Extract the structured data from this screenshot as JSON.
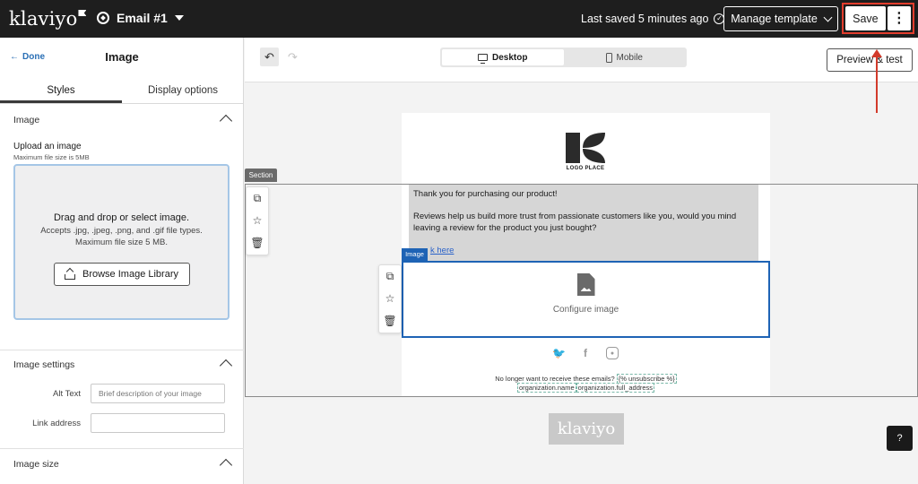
{
  "topbar": {
    "logo": "klaviyo",
    "email_name": "Email #1",
    "saved_status": "Last saved 5 minutes ago",
    "manage_label": "Manage template",
    "save_label": "Save",
    "more_label": "⋮"
  },
  "left_panel": {
    "done_label": "Done",
    "title": "Image",
    "tabs": [
      {
        "label": "Styles",
        "active": true
      },
      {
        "label": "Display options",
        "active": false
      }
    ],
    "image_section": {
      "title": "Image",
      "upload_label": "Upload an image",
      "upload_hint": "Maximum file size is 5MB",
      "dropzone_title": "Drag and drop or select image.",
      "dropzone_line1": "Accepts .jpg, .jpeg, .png, and .gif file types.",
      "dropzone_line2": "Maximum file size 5 MB.",
      "browse_label": "Browse Image Library"
    },
    "settings_section": {
      "title": "Image settings",
      "alt_label": "Alt Text",
      "alt_placeholder": "Brief description of your image",
      "link_label": "Link address",
      "link_value": ""
    },
    "size_section": {
      "title": "Image size"
    }
  },
  "canvas_bar": {
    "undo": "↶",
    "redo": "↷",
    "devices": [
      {
        "label": "Desktop",
        "active": true
      },
      {
        "label": "Mobile",
        "active": false
      }
    ],
    "preview_label": "Preview & test"
  },
  "email": {
    "logo_caption": "LOGO PLACE",
    "section_tag": "Section",
    "image_tag": "Image",
    "text_line1": "Thank you for purchasing our product!",
    "text_line2": "Reviews help us build more trust from passionate customers like you, would you mind leaving a review for the product you just bought?",
    "link_text": "k here",
    "configure_label": "Configure image",
    "unsub_text": "No longer want to receive these emails?",
    "unsub_tag": "{% unsubscribe %}",
    "org_name": "organization.name",
    "org_address": "organization.full_address",
    "footer_logo": "klaviyo"
  },
  "help_label": "?",
  "colors": {
    "accent_blue": "#1e63b5",
    "save_highlight": "#e23d2d",
    "topbar": "#1e1e1e"
  }
}
